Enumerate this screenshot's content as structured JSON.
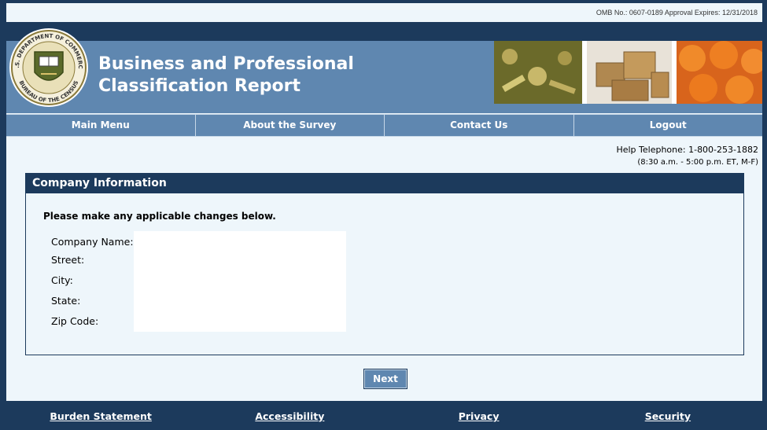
{
  "omb": "OMB No.: 0607-0189 Approval Expires: 12/31/2018",
  "header": {
    "title_line1": "Business and Professional",
    "title_line2": "Classification Report",
    "seal_text_top": "U.S. DEPARTMENT OF COMMERCE",
    "seal_text_bottom": "BUREAU OF THE CENSUS"
  },
  "nav": {
    "items": [
      {
        "label": "Main Menu"
      },
      {
        "label": "About the Survey"
      },
      {
        "label": "Contact Us"
      },
      {
        "label": "Logout"
      }
    ]
  },
  "help": {
    "phone": "Help Telephone: 1-800-253-1882",
    "hours": "(8:30 a.m. - 5:00 p.m. ET, M-F)"
  },
  "panel": {
    "title": "Company Information",
    "instructions": "Please make any applicable changes below.",
    "fields": [
      {
        "label": "Company Name:"
      },
      {
        "label": "Street:"
      },
      {
        "label": "City:"
      },
      {
        "label": "State:"
      },
      {
        "label": "Zip Code:"
      }
    ]
  },
  "actions": {
    "next_label": "Next"
  },
  "footer": {
    "links": [
      {
        "label": "Burden Statement"
      },
      {
        "label": "Accessibility"
      },
      {
        "label": "Privacy"
      },
      {
        "label": "Security"
      }
    ]
  },
  "colors": {
    "dark_navy": "#1c3a5c",
    "banner_blue": "#5f87b0",
    "page_bg": "#eef6fb"
  }
}
